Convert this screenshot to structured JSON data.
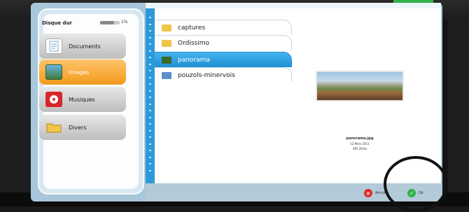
{
  "disk": {
    "title": "Disque dur",
    "usage_fraction": 0.7,
    "usage_text": "1%"
  },
  "categories": [
    {
      "label": "Documents",
      "icon": "document-icon",
      "active": false
    },
    {
      "label": "Images",
      "icon": "image-icon",
      "active": true
    },
    {
      "label": "Musiques",
      "icon": "music-icon",
      "active": false
    },
    {
      "label": "Divers",
      "icon": "folder-icon",
      "active": false
    }
  ],
  "folders": [
    {
      "label": "captures",
      "selected": false
    },
    {
      "label": "Ordissimo",
      "selected": false
    },
    {
      "label": "panorama",
      "selected": true
    },
    {
      "label": "pouzols-minervois",
      "selected": false
    }
  ],
  "preview": {
    "filename": "panorama.jpg",
    "date": "12 Mars 2011",
    "size": "465.28 Ko"
  },
  "actions": {
    "cancel_label": "Annuler",
    "ok_label": "Ok"
  },
  "colors": {
    "accent_blue": "#2c9ad8",
    "active_orange": "#f29a1d",
    "ok_green": "#2fb24a",
    "cancel_red": "#e0282c"
  }
}
